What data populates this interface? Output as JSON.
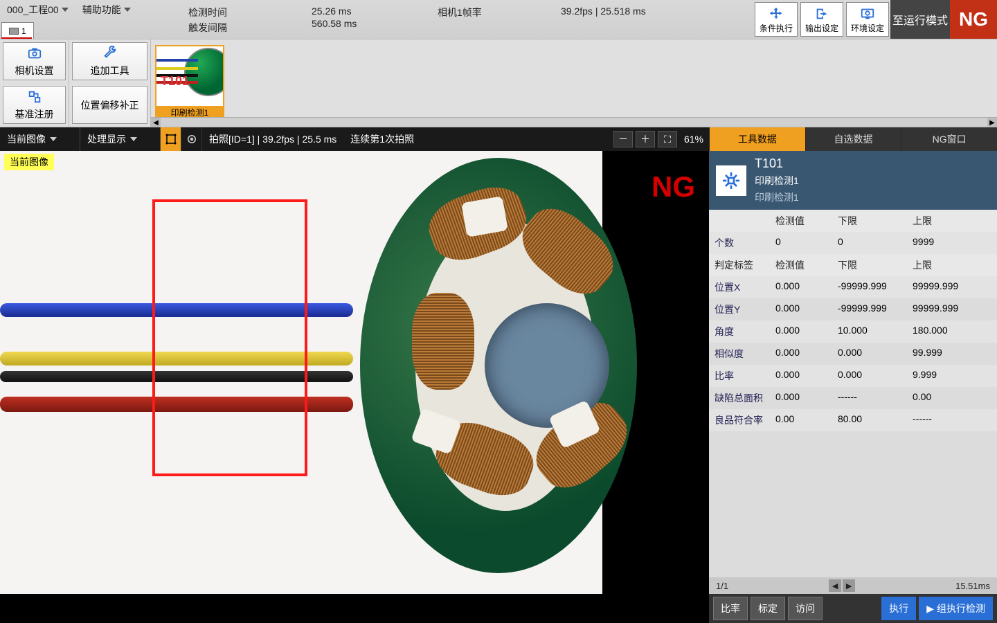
{
  "topbar": {
    "project_menu": "000_工程00",
    "aux_menu": "辅助功能",
    "status": {
      "detect_time_label": "检测时间",
      "trigger_interval_label": "触发间隔",
      "detect_time_value": "25.26 ms",
      "trigger_interval_value": "560.58 ms",
      "camera_rate_label": "相机1帧率",
      "camera_rate_value": "39.2fps | 25.518 ms"
    },
    "project_tab": "1",
    "right_buttons": {
      "cond_exec": "条件执行",
      "output_set": "输出设定",
      "env_set": "环境设定",
      "run_mode": "至运行模式"
    },
    "ng_badge": "NG"
  },
  "tool_row": {
    "camera_setting": "相机设置",
    "ref_register": "基准注册",
    "add_tool": "追加工具",
    "pos_offset": "位置偏移补正",
    "thumb_caption": "印刷检测1",
    "thumb_label": "T101"
  },
  "view_bar": {
    "current_image": "当前图像",
    "process_display": "处理显示",
    "capture_info": "拍照[ID=1] | 39.2fps | 25.5 ms",
    "continuous_info": "连续第1次拍照",
    "zoom_pct": "61%"
  },
  "image_pane": {
    "current_image_label": "当前图像",
    "ng_overlay": "NG"
  },
  "side_tabs": {
    "tool_data": "工具数据",
    "custom_data": "自选数据",
    "ng_window": "NG窗口"
  },
  "tool_head": {
    "id": "T101",
    "name": "印刷检测1",
    "sub": "印刷检测1"
  },
  "data_table": {
    "headers": [
      "",
      "检测值",
      "下限",
      "上限"
    ],
    "headers2": [
      "判定标签",
      "检测值",
      "下限",
      "上限"
    ],
    "rows_a": [
      {
        "label": "个数",
        "v": "0",
        "lo": "0",
        "hi": "9999"
      }
    ],
    "rows_b": [
      {
        "label": "位置X",
        "v": "0.000",
        "lo": "-99999.999",
        "hi": "99999.999"
      },
      {
        "label": "位置Y",
        "v": "0.000",
        "lo": "-99999.999",
        "hi": "99999.999"
      },
      {
        "label": "角度",
        "v": "0.000",
        "lo": "10.000",
        "hi": "180.000"
      },
      {
        "label": "相似度",
        "v": "0.000",
        "lo": "0.000",
        "hi": "99.999"
      },
      {
        "label": "比率",
        "v": "0.000",
        "lo": "0.000",
        "hi": "9.999"
      },
      {
        "label": "缺陷总面积",
        "v": "0.000",
        "lo": "------",
        "hi": "0.00"
      },
      {
        "label": "良品符合率",
        "v": "0.00",
        "lo": "80.00",
        "hi": "------"
      }
    ]
  },
  "footer": {
    "page": "1/1",
    "time": "15.51ms",
    "ratio": "比率",
    "calibrate": "标定",
    "access": "访问",
    "execute": "执行",
    "group_exec": "组执行检测"
  }
}
